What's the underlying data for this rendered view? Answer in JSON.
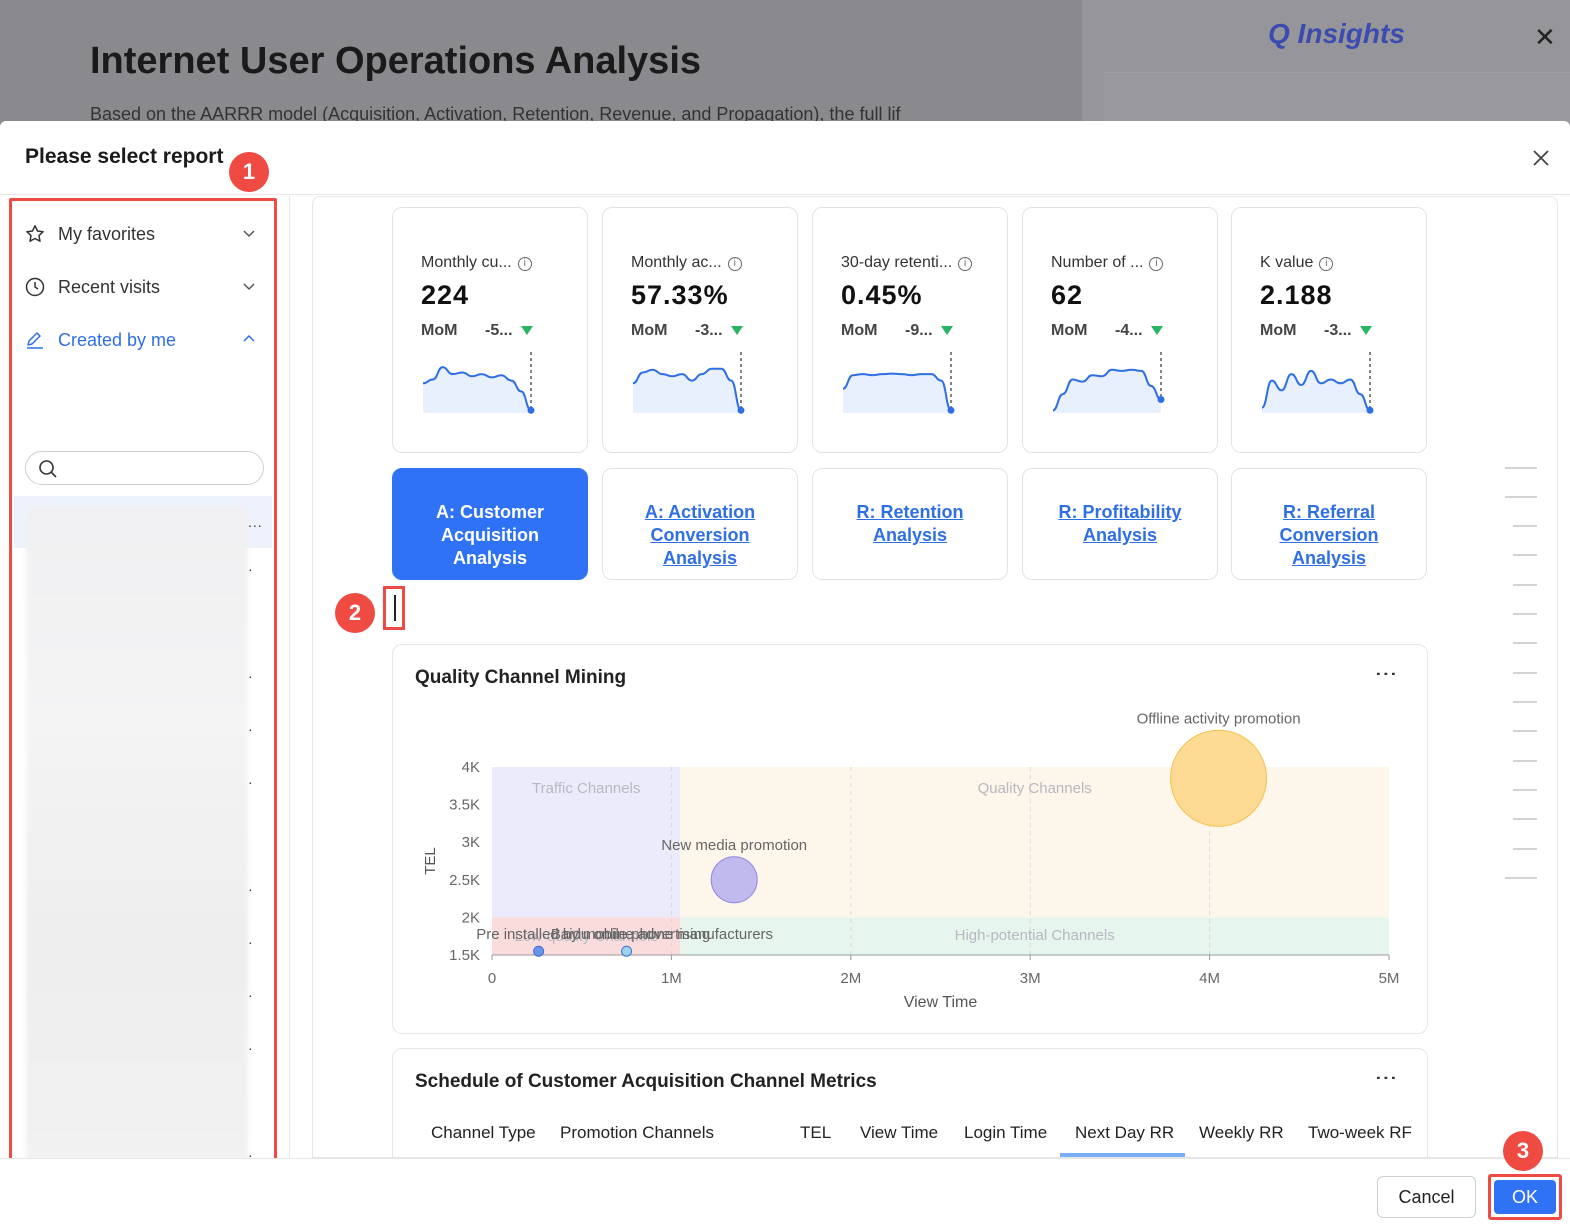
{
  "background": {
    "title": "Internet User Operations Analysis",
    "description": "Based on the AARRR model (Acquisition, Activation, Retention, Revenue, and Propagation), the full lif",
    "logo": "Q Insights"
  },
  "modal": {
    "title": "Please select report",
    "close": "×"
  },
  "badges": {
    "one": "1",
    "two": "2",
    "three": "3"
  },
  "sidebar": {
    "items": [
      {
        "label": "My favorites",
        "icon": "star-icon"
      },
      {
        "label": "Recent visits",
        "icon": "clock-icon"
      },
      {
        "label": "Created by me",
        "icon": "edit-icon"
      }
    ],
    "search_placeholder": "",
    "more_label": "..."
  },
  "kpis": [
    {
      "label": "Monthly cu...",
      "value": "224",
      "mom_label": "MoM",
      "mom_value": "-5...",
      "trend": [
        0.55,
        0.62,
        0.85,
        0.72,
        0.75,
        0.68,
        0.72,
        0.66,
        0.7,
        0.6,
        0.4,
        0.05
      ]
    },
    {
      "label": "Monthly ac...",
      "value": "57.33%",
      "mom_label": "MoM",
      "mom_value": "-3...",
      "trend": [
        0.55,
        0.75,
        0.8,
        0.72,
        0.68,
        0.72,
        0.6,
        0.72,
        0.82,
        0.82,
        0.6,
        0.05
      ]
    },
    {
      "label": "30-day retenti...",
      "value": "0.45%",
      "mom_label": "MoM",
      "mom_value": "-9...",
      "trend": [
        0.45,
        0.7,
        0.72,
        0.7,
        0.72,
        0.73,
        0.72,
        0.7,
        0.72,
        0.72,
        0.6,
        0.05
      ]
    },
    {
      "label": "Number of ...",
      "value": "62",
      "mom_label": "MoM",
      "mom_value": "-4...",
      "trend": [
        0.05,
        0.35,
        0.62,
        0.58,
        0.7,
        0.68,
        0.8,
        0.78,
        0.8,
        0.78,
        0.5,
        0.25
      ]
    },
    {
      "label": "K value",
      "value": "2.188",
      "mom_label": "MoM",
      "mom_value": "-3...",
      "trend": [
        0.1,
        0.6,
        0.42,
        0.72,
        0.52,
        0.78,
        0.55,
        0.62,
        0.55,
        0.62,
        0.35,
        0.05
      ]
    }
  ],
  "tabs": [
    {
      "label": "A: Customer Acquisition Analysis",
      "active": true
    },
    {
      "label": "A: Activation Conversion Analysis",
      "active": false
    },
    {
      "label": "R: Retention Analysis",
      "active": false
    },
    {
      "label": "R: Profitability Analysis",
      "active": false
    },
    {
      "label": "R: Referral Conversion Analysis",
      "active": false
    }
  ],
  "panels": {
    "quality": {
      "title": "Quality Channel Mining"
    },
    "schedule": {
      "title": "Schedule of Customer Acquisition Channel Metrics",
      "columns": [
        "Channel Type",
        "Promotion Channels",
        "TEL",
        "View Time",
        "Login Time",
        "Next Day RR",
        "Weekly RR",
        "Two-week RF"
      ]
    }
  },
  "chart_data": {
    "type": "scatter",
    "xlabel": "View Time",
    "ylabel": "TEL",
    "xlim": [
      0,
      5000000
    ],
    "ylim": [
      1500,
      4000
    ],
    "xticks": [
      "0",
      "1M",
      "2M",
      "3M",
      "4M",
      "5M"
    ],
    "yticks": [
      "1.5K",
      "2K",
      "2.5K",
      "3K",
      "3.5K",
      "4K"
    ],
    "quadrants": [
      {
        "label": "Traffic Channels",
        "color": "#ecebfb"
      },
      {
        "label": "Quality Channels",
        "color": "#fdf6ea"
      },
      {
        "label": "Low-quality Channels",
        "color": "#fbdcdc"
      },
      {
        "label": "High-potential Channels",
        "color": "#e6f5ee"
      }
    ],
    "points": [
      {
        "name": "Offline activity promotion",
        "x": 4050000,
        "y": 3850,
        "size": 48,
        "color": "#fdd78a"
      },
      {
        "name": "New media promotion",
        "x": 1350000,
        "y": 2500,
        "size": 23,
        "color": "#b9b4f0"
      },
      {
        "name": "Pre installed by mobile phone manufacturers",
        "x": 260000,
        "y": 1550,
        "size": 5,
        "color": "#5a8de8"
      },
      {
        "name": "Baidu online advertising",
        "x": 750000,
        "y": 1550,
        "size": 5,
        "color": "#8fd3f0"
      }
    ]
  },
  "footer": {
    "cancel_label": "Cancel",
    "ok_label": "OK"
  }
}
